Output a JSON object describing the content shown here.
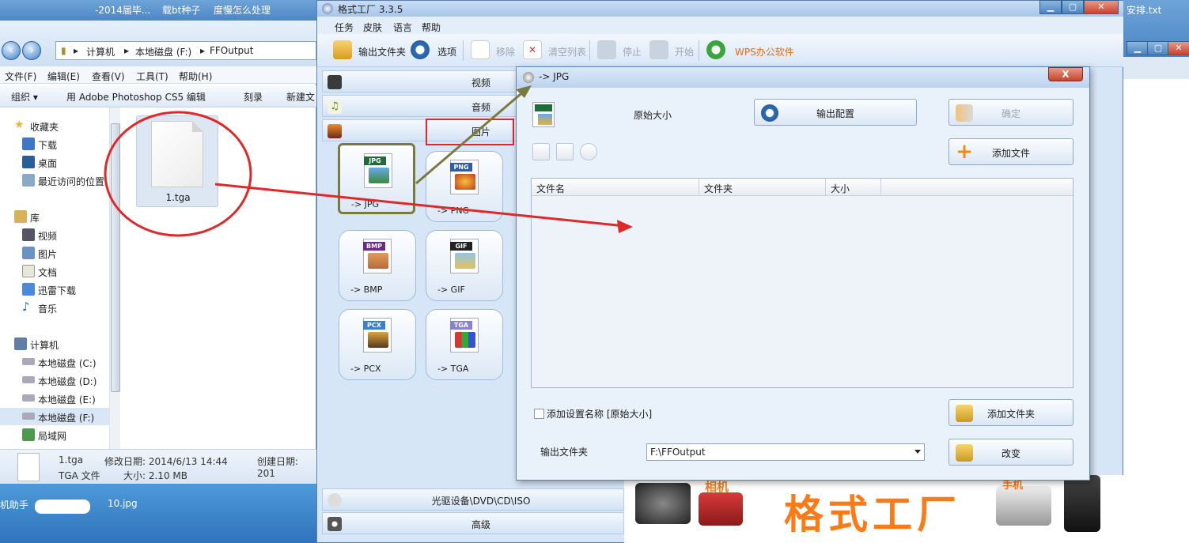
{
  "desktop": {
    "top_items": [
      "-2014届毕...",
      "载bt种子",
      "度慢怎么处理"
    ],
    "taskbar_items": [
      "机助手",
      "10.jpg"
    ],
    "right_file": "安排.txt"
  },
  "explorer": {
    "address": [
      "计算机",
      "本地磁盘 (F:)",
      "FFOutput"
    ],
    "menu": [
      "文件(F)",
      "编辑(E)",
      "查看(V)",
      "工具(T)",
      "帮助(H)"
    ],
    "toolbar": [
      "组织 ▾",
      "用 Adobe Photoshop CS5 编辑",
      "刻录",
      "新建文"
    ],
    "nav": {
      "favorites_header": "收藏夹",
      "favorites": [
        "下载",
        "桌面",
        "最近访问的位置"
      ],
      "library_header": "库",
      "library": [
        "视频",
        "图片",
        "文档",
        "迅雷下载",
        "音乐"
      ],
      "computer_header": "计算机",
      "drives": [
        "本地磁盘 (C:)",
        "本地磁盘 (D:)",
        "本地磁盘 (E:)",
        "本地磁盘 (F:)"
      ],
      "network": "局域网"
    },
    "file": {
      "name": "1.tga"
    },
    "details": {
      "name": "1.tga",
      "type": "TGA 文件",
      "modified_label": "修改日期: 2014/6/13 14:44",
      "size_label": "大小: 2.10 MB",
      "created_label": "创建日期: 201"
    }
  },
  "formatfactory": {
    "title": "格式工厂 3.3.5",
    "menu": [
      "任务",
      "皮肤",
      "语言",
      "帮助"
    ],
    "toolbar": {
      "output_folder": "输出文件夹",
      "options": "选项",
      "remove": "移除",
      "clear_list": "清空列表",
      "stop": "停止",
      "start": "开始",
      "wps": "WPS办公软件"
    },
    "categories": {
      "video": "视频",
      "audio": "音频",
      "image": "图片",
      "optical": "光驱设备\\DVD\\CD\\ISO",
      "advanced": "高级"
    },
    "formats": [
      {
        "tag": "JPG",
        "label": "-> JPG",
        "tag_color": "#1f6b3a"
      },
      {
        "tag": "PNG",
        "label": "-> PNG",
        "tag_color": "#2e5ea8"
      },
      {
        "tag": "BMP",
        "label": "-> BMP",
        "tag_color": "#6a2a8a"
      },
      {
        "tag": "GIF",
        "label": "-> GIF",
        "tag_color": "#222222"
      },
      {
        "tag": "PCX",
        "label": "-> PCX",
        "tag_color": "#3a7fd0"
      },
      {
        "tag": "TGA",
        "label": "-> TGA",
        "tag_color": "#8a7fd6"
      }
    ],
    "banner": {
      "brand": "格式工厂",
      "camera_label": "相机",
      "phone_label": "手机"
    }
  },
  "dialog": {
    "title": "-> JPG",
    "close_label": "X",
    "preset": "原始大小",
    "output_config_button": "输出配置",
    "ok_button": "确定",
    "add_file_button": "添加文件",
    "columns": [
      "文件名",
      "文件夹",
      "大小"
    ],
    "append_setting_label": "添加设置名称 [原始大小]",
    "add_folder_button": "添加文件夹",
    "output_folder_label": "输出文件夹",
    "output_folder_value": "F:\\FFOutput",
    "change_button": "改变"
  },
  "colors": {
    "annotation_red": "#e02828",
    "annotation_olive": "#7a7a3e",
    "brand_orange": "#ff7a14"
  }
}
